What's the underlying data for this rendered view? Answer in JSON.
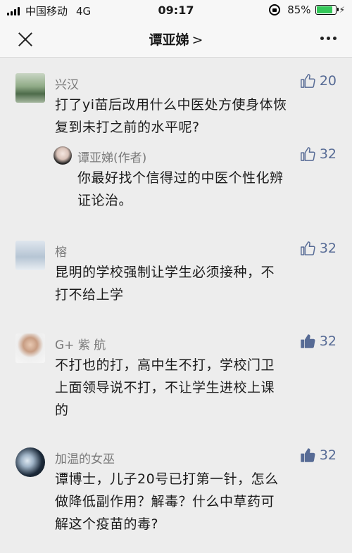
{
  "status": {
    "carrier": "中国移动",
    "network": "4G",
    "time": "09:17",
    "battery": "85%",
    "battery_level": 0.85
  },
  "nav": {
    "title": "谭亚娣",
    "chevron": ">"
  },
  "comments": [
    {
      "name": "兴汉",
      "likes": "20",
      "liked": false,
      "text": [
        "打了yi苗后改用什么中医处方使身体恢",
        "复到未打之前的水平呢?"
      ],
      "reply": {
        "name": "谭亚娣(作者)",
        "likes": "32",
        "liked": false,
        "text": [
          "你最好找个信得过的中医个性化辨",
          "证论治。"
        ]
      }
    },
    {
      "name": "榕",
      "likes": "32",
      "liked": false,
      "text": [
        "昆明的学校强制让学生必须接种，不",
        "打不给上学"
      ]
    },
    {
      "name": "G+ 紫 航",
      "likes": "32",
      "liked": true,
      "text": [
        "不打也的打，高中生不打，学校门卫",
        "上面领导说不打，不让学生进校上课",
        "的"
      ]
    },
    {
      "name": "加温的女巫",
      "likes": "32",
      "liked": true,
      "text": [
        "谭博士，儿子20号已打第一针，怎么",
        "做降低副作用？解毒？什么中草药可",
        "解这个疫苗的毒?"
      ]
    }
  ]
}
